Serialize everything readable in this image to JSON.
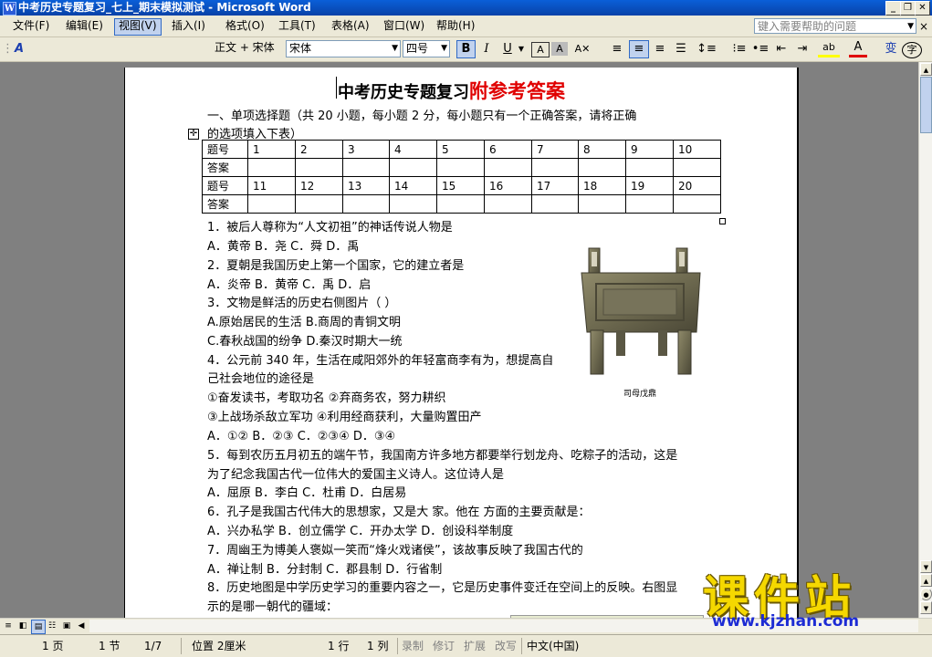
{
  "window": {
    "title": "中考历史专题复习_七上_期末模拟测试 - Microsoft Word"
  },
  "menu": [
    "文件(F)",
    "编辑(E)",
    "视图(V)",
    "插入(I)",
    "格式(O)",
    "工具(T)",
    "表格(A)",
    "窗口(W)",
    "帮助(H)"
  ],
  "help_placeholder": "键入需要帮助的问题",
  "toolbar": {
    "style": "正文 + 宋体",
    "font": "宋体",
    "size": "四号",
    "bold": "B",
    "italic": "I",
    "underline": "U"
  },
  "document": {
    "title_black": "中考历史专题复习",
    "title_red": "附参考答案",
    "section_heading_1": "一、单项选择题（共 20 小题，每小题 2 分，每小题只有一个正确答案，请将正确",
    "section_heading_2": "的选项填入下表）",
    "table": {
      "row_label_num": "题号",
      "row_label_ans": "答案",
      "nums_1": [
        "1",
        "2",
        "3",
        "4",
        "5",
        "6",
        "7",
        "8",
        "9",
        "10"
      ],
      "nums_2": [
        "11",
        "12",
        "13",
        "14",
        "15",
        "16",
        "17",
        "18",
        "19",
        "20"
      ]
    },
    "lines": [
      "1．被后人尊称为“人文初祖”的神话传说人物是",
      " A．黄帝     B．尧      C．舜      D．禹",
      "2．夏朝是我国历史上第一个国家，它的建立者是",
      "A．炎帝      B．黄帝      C．禹        D．启",
      "3．文物是鲜活的历史右侧图片（      ）",
      "A.原始居民的生活    B.商周的青铜文明",
      "C.春秋战国的纷争    D.秦汉时期大一统",
      "4．公元前 340 年，生活在咸阳郊外的年轻富商李有为，想提高自",
      "己社会地位的途径是",
      "①奋发读书，考取功名      ②弃商务农，努力耕织",
      "③上战场杀敌立军功      ④利用经商获利，大量购置田产",
      "A．①②    B．②③    C．②③④     D．③④",
      "5．每到农历五月初五的端午节，我国南方许多地方都要举行划龙舟、吃粽子的活动，这是",
      "为了纪念我国古代一位伟大的爱国主义诗人。这位诗人是",
      "A．屈原              B．李白            C．杜甫            D．白居易",
      "6．孔子是我国古代伟大的思想家，又是大    家。他在    方面的主要贡献是：",
      "A．兴办私学      B．创立儒学          C．开办太学      D．创设科举制度",
      "7．周幽王为博美人褒姒一笑而“烽火戏诸侯”，该故事反映了我国古代的",
      "       A．禅让制            B．分封制            C．郡县制            D．行省制",
      "8．历史地图是中学历史学习的重要内容之一，它是历史事件变迁在空间上的反映。右图显",
      "示的是哪一朝代的疆域："
    ],
    "image_caption": "司母戊鼎"
  },
  "logo": {
    "text": "课件站",
    "url": "www.kjzhan.com"
  },
  "status": {
    "page": "1 页",
    "section": "1 节",
    "pages": "1/7",
    "position": "位置 2厘米",
    "line": "1 行",
    "col": "1 列",
    "rec": "录制",
    "trk": "修订",
    "ext": "扩展",
    "ovr": "改写",
    "lang": "中文(中国)"
  }
}
